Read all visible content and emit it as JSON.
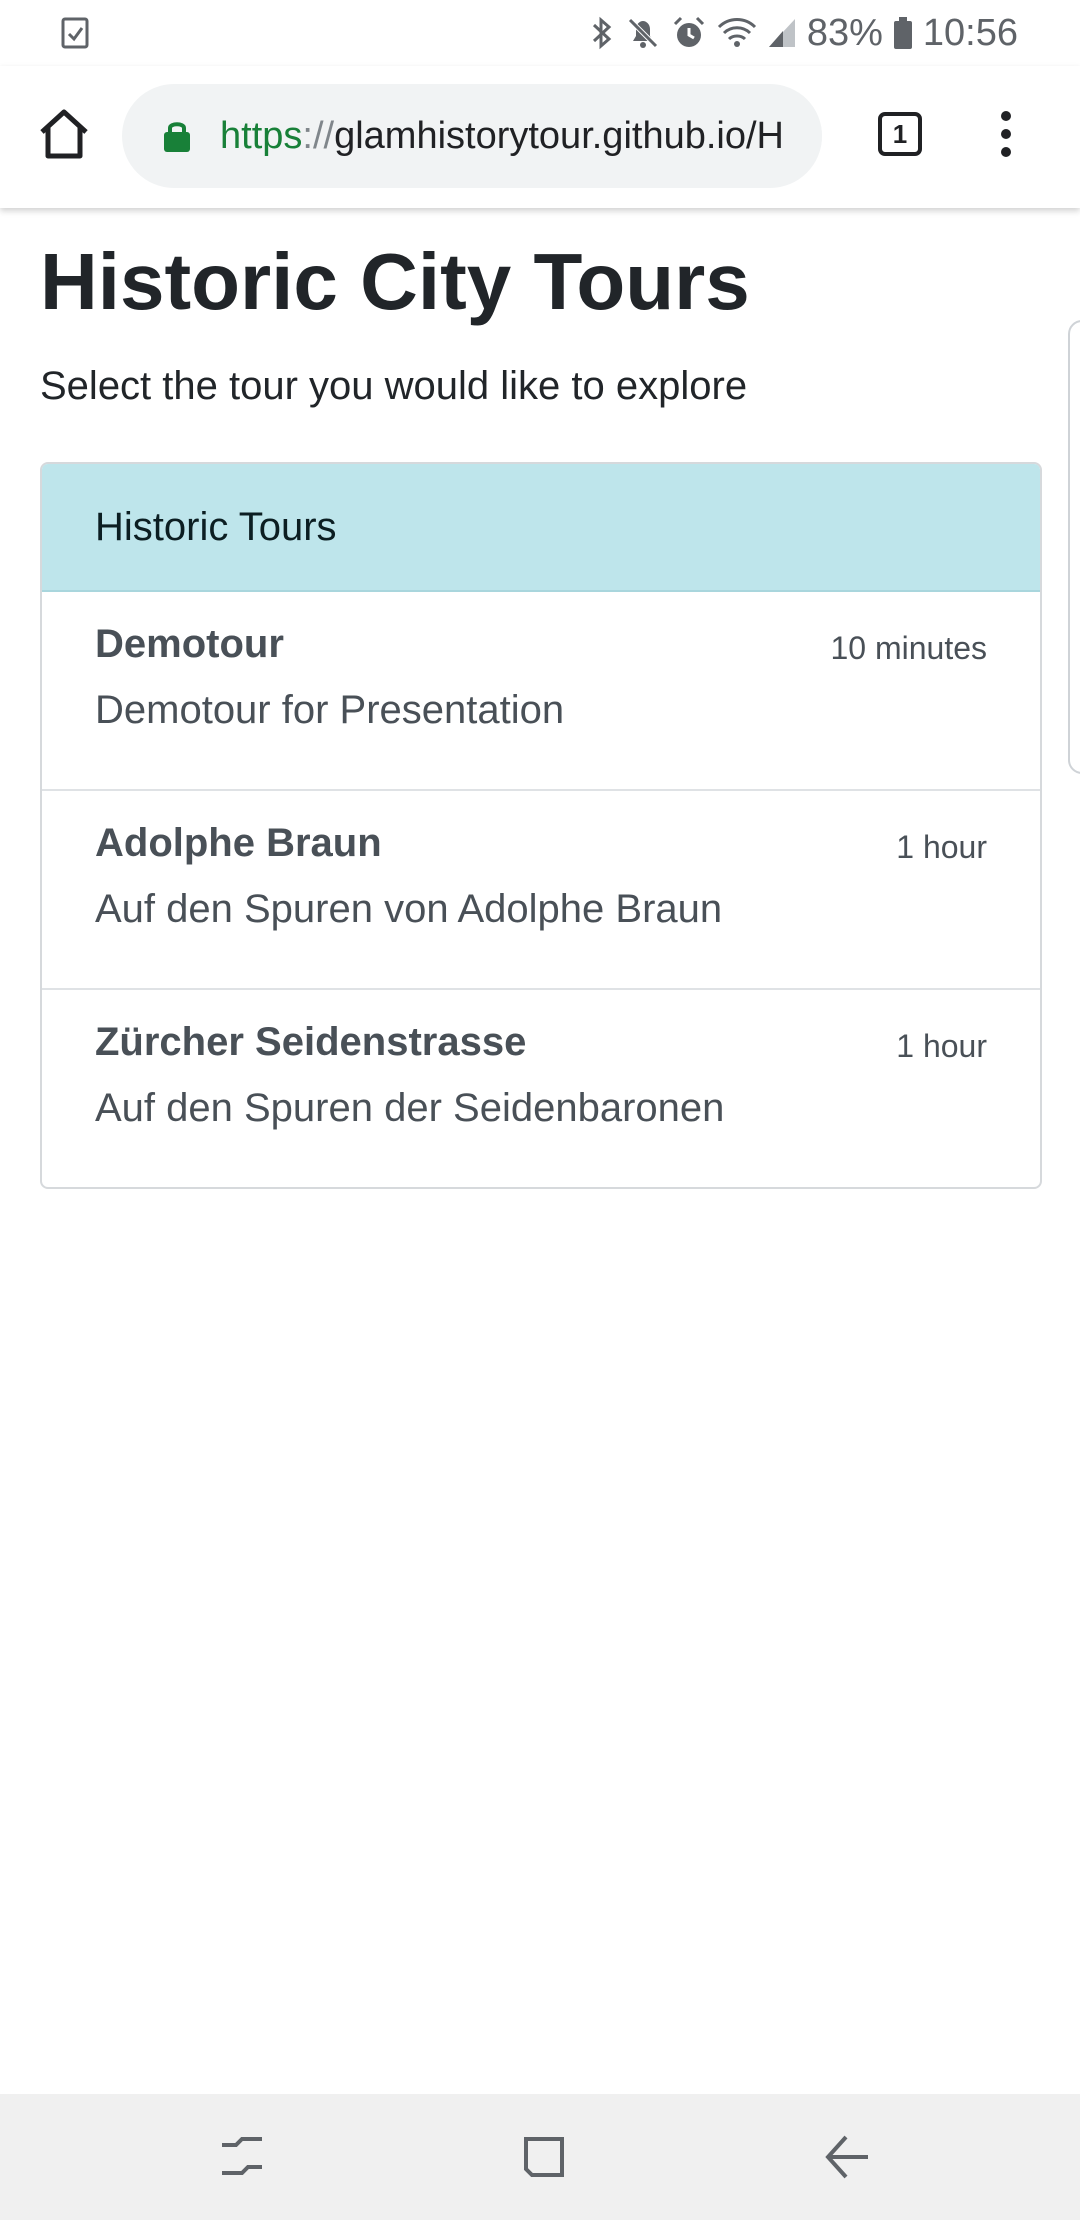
{
  "status_bar": {
    "battery": "83%",
    "time": "10:56",
    "icons": [
      "screenshot-icon",
      "bluetooth-icon",
      "mute-icon",
      "alarm-icon",
      "wifi-icon",
      "signal-icon",
      "battery-icon"
    ]
  },
  "browser": {
    "url_scheme": "https",
    "url_separator": "://",
    "url_host": "glamhistorytour.github.io/H",
    "tab_count": "1",
    "icons": [
      "home-icon",
      "lock-icon",
      "tab-switcher-icon",
      "more-menu-icon"
    ],
    "colors": {
      "lock": "#188038",
      "scheme": "#188038",
      "url_bar_bg": "#f1f3f4"
    }
  },
  "page": {
    "title": "Historic City Tours",
    "subtitle": "Select the tour you would like to explore",
    "list_header": "Historic Tours",
    "colors": {
      "header_bg": "#bee5eb",
      "text": "#495057"
    },
    "tours": [
      {
        "name": "Demotour",
        "duration": "10 minutes",
        "description": "Demotour for Presentation"
      },
      {
        "name": "Adolphe Braun",
        "duration": "1 hour",
        "description": "Auf den Spuren von Adolphe Braun"
      },
      {
        "name": "Zürcher Seidenstrasse",
        "duration": "1 hour",
        "description": "Auf den Spuren der Seidenbaronen"
      }
    ]
  },
  "nav_bar": {
    "icons": [
      "recent-apps-icon",
      "home-nav-icon",
      "back-icon"
    ]
  }
}
